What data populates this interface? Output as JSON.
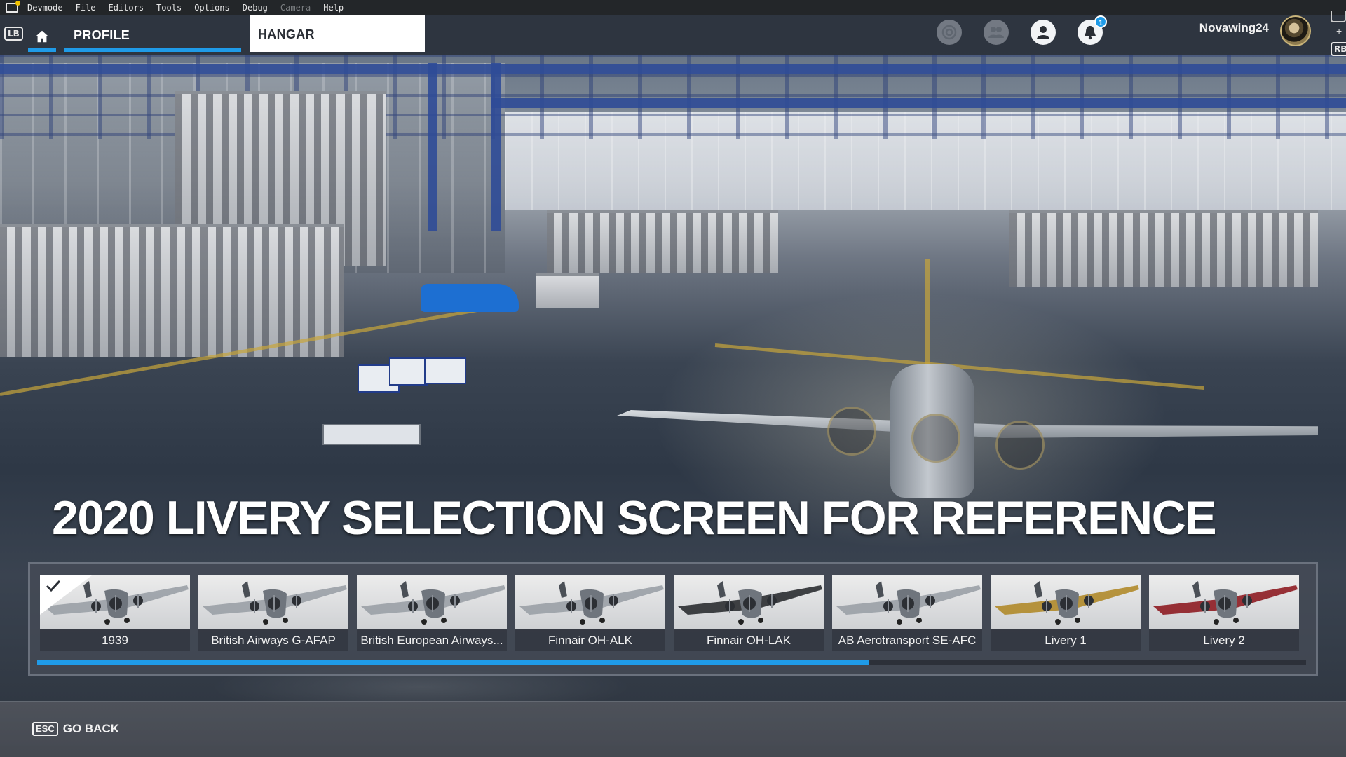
{
  "dev_menu": {
    "items": [
      {
        "label": "Devmode",
        "enabled": true
      },
      {
        "label": "File",
        "enabled": true
      },
      {
        "label": "Editors",
        "enabled": true
      },
      {
        "label": "Tools",
        "enabled": true
      },
      {
        "label": "Options",
        "enabled": true
      },
      {
        "label": "Debug",
        "enabled": true
      },
      {
        "label": "Camera",
        "enabled": false
      },
      {
        "label": "Help",
        "enabled": true
      }
    ]
  },
  "nav": {
    "lb_hint": "LB",
    "rb_hint": "RB",
    "rb_plus": "+",
    "home_icon": "home-icon",
    "tabs": [
      {
        "label": "PROFILE",
        "active": true
      },
      {
        "label": "HANGAR",
        "active": false,
        "selected": true
      }
    ],
    "icons": [
      "activity-icon",
      "friends-icon",
      "account-icon",
      "bell-icon"
    ],
    "notification_count": "1",
    "username": "Novawing24",
    "accent_color": "#1f9be8"
  },
  "headline": "2020 LIVERY SELECTION SCREEN FOR REFERENCE",
  "liveries": [
    {
      "name": "1939",
      "selected": true,
      "accent": "#9aa0a6"
    },
    {
      "name": "British Airways G-AFAP",
      "selected": false,
      "accent": "#9aa0a6"
    },
    {
      "name": "British European Airways...",
      "selected": false,
      "accent": "#9aa0a6"
    },
    {
      "name": "Finnair OH-ALK",
      "selected": false,
      "accent": "#9aa0a6"
    },
    {
      "name": "Finnair OH-LAK",
      "selected": false,
      "accent": "#2b2d31"
    },
    {
      "name": "AB Aerotransport SE-AFC",
      "selected": false,
      "accent": "#9aa0a6"
    },
    {
      "name": "Livery 1",
      "selected": false,
      "accent": "#b08a2a"
    },
    {
      "name": "Livery 2",
      "selected": false,
      "accent": "#8e1c22"
    }
  ],
  "scroll_progress": 0.655,
  "footer": {
    "esc_key": "ESC",
    "go_back_label": "GO BACK"
  }
}
